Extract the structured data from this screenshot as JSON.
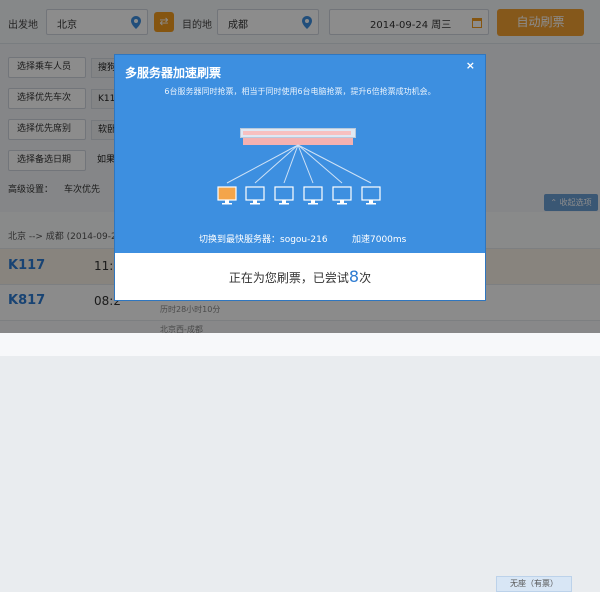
{
  "search": {
    "from_label": "出发地",
    "from_value": "北京",
    "swap_icon": "swap-icon",
    "to_label": "目的地",
    "to_value": "成都",
    "date_value": "2014-09-24 周三",
    "auto_button": "自动刷票"
  },
  "filters": {
    "passengers": "选择乘车人员",
    "passenger_tag": "搜狗",
    "priority_train": "选择优先车次",
    "priority_train_tag": "K11",
    "priority_seat": "选择优先席别",
    "priority_seat_tag": "软卧",
    "backup_date": "选择备选日期",
    "backup_note": "如果您",
    "advanced_label": "高级设置：",
    "advanced_value": "车次优先",
    "collapse": "收起选项"
  },
  "results": {
    "route": "北京 --> 成都 (2014-09-24",
    "rows": [
      {
        "train": "K117",
        "time": "11:1",
        "sub": ""
      },
      {
        "train": "K817",
        "time": "08:2",
        "sub": "历时28小时10分"
      },
      {
        "train": "",
        "time": "",
        "sub": "北京西-成都"
      }
    ],
    "no_seat": "无座（有票）"
  },
  "modal": {
    "title": "多服务器加速刷票",
    "close": "×",
    "description": "6台服务器同时抢票，相当于同时使用6台电脑抢票，提升6倍抢票成功机会。",
    "switch_text": "切换到最快服务器：sogou-216",
    "speed_text": "加速7000ms",
    "status_prefix": "正在为您刷票，已尝试",
    "status_count": "8",
    "status_suffix": "次"
  },
  "colors": {
    "accent": "#3d8fe0",
    "orange": "#f3a032",
    "link_blue": "#2d7bd1",
    "active_monitor": "#f4a54a"
  }
}
